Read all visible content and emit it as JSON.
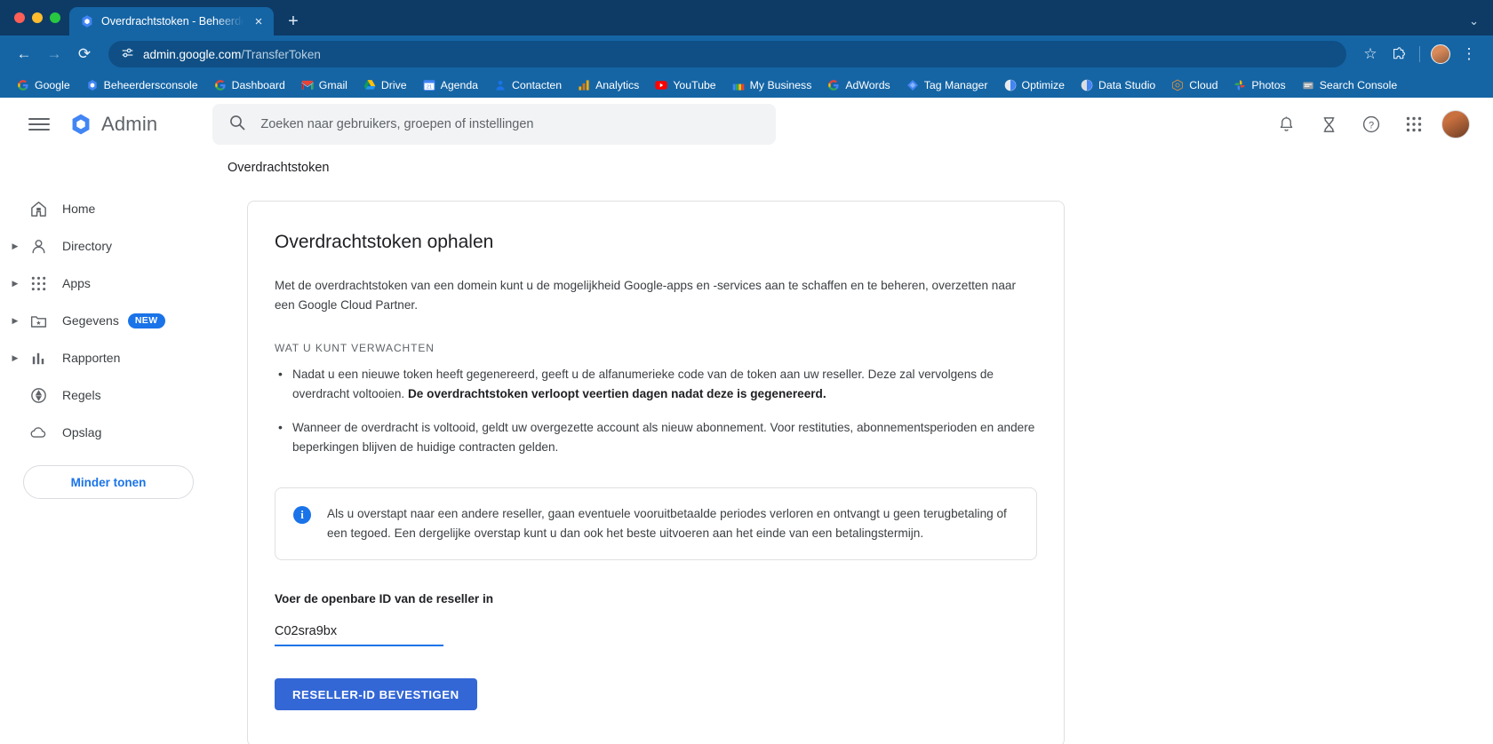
{
  "browser": {
    "tab": {
      "title": "Overdrachtstoken - Beheerde",
      "favicon": "google-admin-icon",
      "close_label": "×"
    },
    "new_tab_label": "+",
    "tabstrip_chevron": "⌄",
    "toolbar": {
      "back": "←",
      "forward": "→",
      "reload": "⟳",
      "site_info_icon": "tune-icon",
      "url_host": "admin.google.com",
      "url_path": "/TransferToken",
      "bookmark_star": "☆",
      "extensions_icon": "puzzle-icon",
      "menu_icon": "⋮"
    },
    "bookmarks": [
      {
        "label": "Google",
        "icon": "google-g-icon"
      },
      {
        "label": "Beheerdersconsole",
        "icon": "admin-console-icon"
      },
      {
        "label": "Dashboard",
        "icon": "google-g-icon"
      },
      {
        "label": "Gmail",
        "icon": "gmail-icon"
      },
      {
        "label": "Drive",
        "icon": "drive-icon"
      },
      {
        "label": "Agenda",
        "icon": "calendar-icon"
      },
      {
        "label": "Contacten",
        "icon": "contacts-icon"
      },
      {
        "label": "Analytics",
        "icon": "analytics-icon"
      },
      {
        "label": "YouTube",
        "icon": "youtube-icon"
      },
      {
        "label": "My Business",
        "icon": "my-business-icon"
      },
      {
        "label": "AdWords",
        "icon": "adwords-icon"
      },
      {
        "label": "Tag Manager",
        "icon": "tag-manager-icon"
      },
      {
        "label": "Optimize",
        "icon": "optimize-icon"
      },
      {
        "label": "Data Studio",
        "icon": "data-studio-icon"
      },
      {
        "label": "Cloud",
        "icon": "cloud-icon"
      },
      {
        "label": "Photos",
        "icon": "photos-icon"
      },
      {
        "label": "Search Console",
        "icon": "search-console-icon"
      }
    ]
  },
  "header": {
    "menu_icon": "hamburger-icon",
    "brand": "Admin",
    "search_placeholder": "Zoeken naar gebruikers, groepen of instellingen",
    "search_value": "",
    "icons": {
      "notifications": "bell-icon",
      "tasks": "hourglass-icon",
      "help": "help-icon",
      "apps": "apps-grid-icon",
      "account": "user-avatar"
    }
  },
  "subheader": {
    "title": "Overdrachtstoken"
  },
  "sidebar": {
    "items": [
      {
        "label": "Home",
        "icon": "home-icon",
        "expandable": false,
        "badge": ""
      },
      {
        "label": "Directory",
        "icon": "person-icon",
        "expandable": true,
        "badge": ""
      },
      {
        "label": "Apps",
        "icon": "apps-grid-icon",
        "expandable": true,
        "badge": ""
      },
      {
        "label": "Gegevens",
        "icon": "folder-star-icon",
        "expandable": true,
        "badge": "NEW"
      },
      {
        "label": "Rapporten",
        "icon": "bar-chart-icon",
        "expandable": true,
        "badge": ""
      },
      {
        "label": "Regels",
        "icon": "shield-icon",
        "expandable": false,
        "badge": ""
      },
      {
        "label": "Opslag",
        "icon": "cloud-icon",
        "expandable": false,
        "badge": ""
      }
    ],
    "show_less_label": "Minder tonen"
  },
  "card": {
    "title": "Overdrachtstoken ophalen",
    "intro": "Met de overdrachtstoken van een domein kunt u de mogelijkheid Google-apps en -services aan te schaffen en te beheren, overzetten naar een Google Cloud Partner.",
    "section_label": "WAT U KUNT VERWACHTEN",
    "bullets": [
      {
        "text": "Nadat u een nieuwe token heeft gegenereerd, geeft u de alfanumerieke code van de token aan uw reseller. Deze zal vervolgens de overdracht voltooien. ",
        "bold": "De overdrachtstoken verloopt veertien dagen nadat deze is gegenereerd."
      },
      {
        "text": "Wanneer de overdracht is voltooid, geldt uw overgezette account als nieuw abonnement. Voor restituties, abonnementsperioden en andere beperkingen blijven de huidige contracten gelden.",
        "bold": ""
      }
    ],
    "info_icon": "info-icon",
    "info_text": "Als u overstapt naar een andere reseller, gaan eventuele vooruitbetaalde periodes verloren en ontvangt u geen terugbetaling of een tegoed. Een dergelijke overstap kunt u dan ook het beste uitvoeren aan het einde van een betalingstermijn.",
    "field_label": "Voer de openbare ID van de reseller in",
    "field_value": "C02sra9bx",
    "field_placeholder": "",
    "submit_label": "RESELLER-ID BEVESTIGEN"
  },
  "colors": {
    "chrome_frame": "#1565a5",
    "chrome_tabstrip": "#0d3b66",
    "accent_blue": "#1a73e8",
    "button_blue": "#3367d6",
    "text_primary": "#202124",
    "text_secondary": "#5f6368"
  }
}
